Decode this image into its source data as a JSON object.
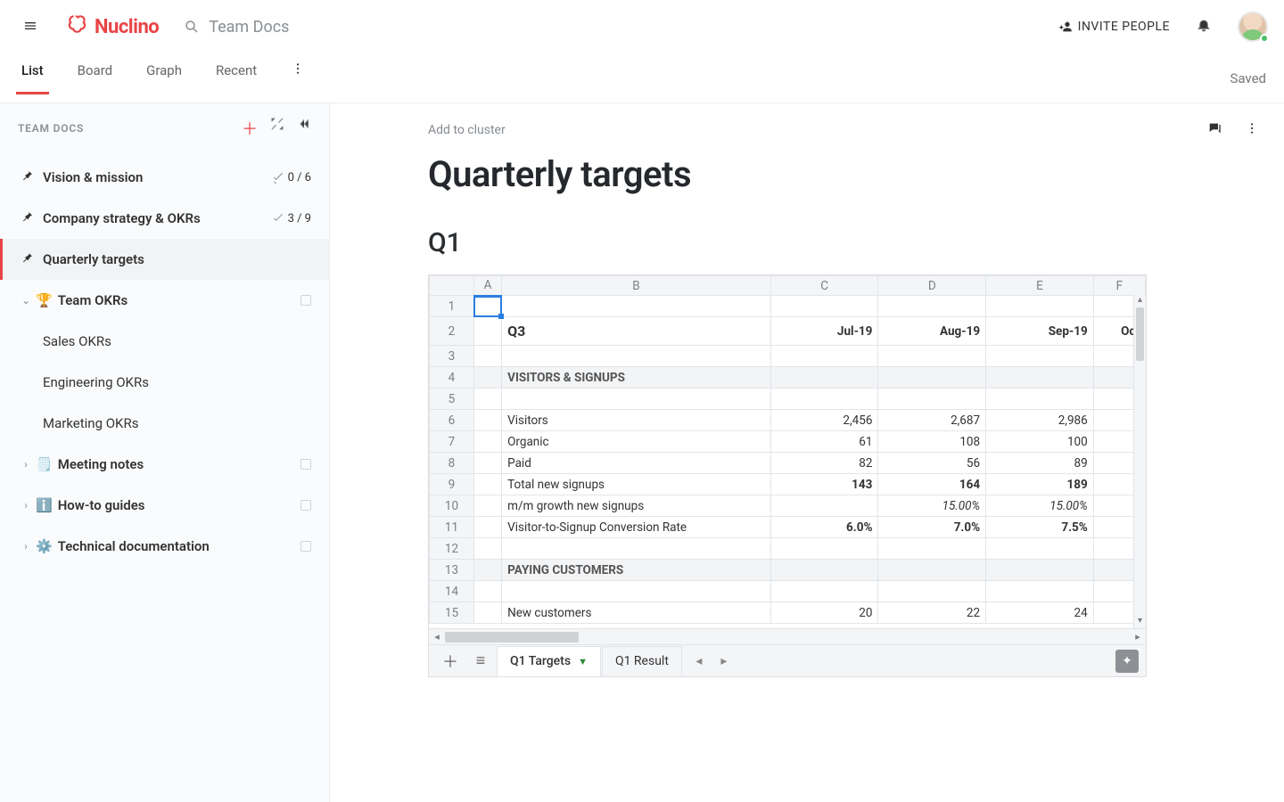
{
  "brand": "Nuclino",
  "search_placeholder": "Team Docs",
  "invite_label": "INVITE PEOPLE",
  "tabs": {
    "list": "List",
    "board": "Board",
    "graph": "Graph",
    "recent": "Recent"
  },
  "save_status": "Saved",
  "sidebar": {
    "heading": "TEAM DOCS",
    "items": [
      {
        "label": "Vision & mission",
        "meta": "0 / 6"
      },
      {
        "label": "Company strategy & OKRs",
        "meta": "3 / 9"
      },
      {
        "label": "Quarterly targets"
      },
      {
        "label": "Team OKRs",
        "emoji": "🏆"
      },
      {
        "label": "Sales OKRs"
      },
      {
        "label": "Engineering OKRs"
      },
      {
        "label": "Marketing OKRs"
      },
      {
        "label": "Meeting notes",
        "emoji": "🗒️"
      },
      {
        "label": "How-to guides",
        "emoji": "ℹ️"
      },
      {
        "label": "Technical documentation",
        "emoji": "⚙️"
      }
    ]
  },
  "doc": {
    "cluster_link": "Add to cluster",
    "title": "Quarterly targets",
    "section": "Q1"
  },
  "sheet": {
    "columns": [
      "A",
      "B",
      "C",
      "D",
      "E",
      "F"
    ],
    "headers": {
      "q": "Q3",
      "jul": "Jul-19",
      "aug": "Aug-19",
      "sep": "Sep-19",
      "oct": "Oct"
    },
    "sections": {
      "visitors": "VISITORS & SIGNUPS",
      "paying": "PAYING CUSTOMERS"
    },
    "rows": {
      "visitors": {
        "label": "Visitors",
        "jul": "2,456",
        "aug": "2,687",
        "sep": "2,986"
      },
      "organic": {
        "label": "Organic",
        "jul": "61",
        "aug": "108",
        "sep": "100"
      },
      "paid": {
        "label": "Paid",
        "jul": "82",
        "aug": "56",
        "sep": "89"
      },
      "signups": {
        "label": "Total new signups",
        "jul": "143",
        "aug": "164",
        "sep": "189"
      },
      "mm": {
        "label": "m/m growth new signups",
        "aug": "15.00%",
        "sep": "15.00%"
      },
      "conv": {
        "label": "Visitor-to-Signup Conversion Rate",
        "jul": "6.0%",
        "aug": "7.0%",
        "sep": "7.5%"
      },
      "newcust": {
        "label": "New customers",
        "jul": "20",
        "aug": "22",
        "sep": "24"
      }
    },
    "tabs": {
      "active": "Q1 Targets",
      "next": "Q1 Result"
    }
  }
}
